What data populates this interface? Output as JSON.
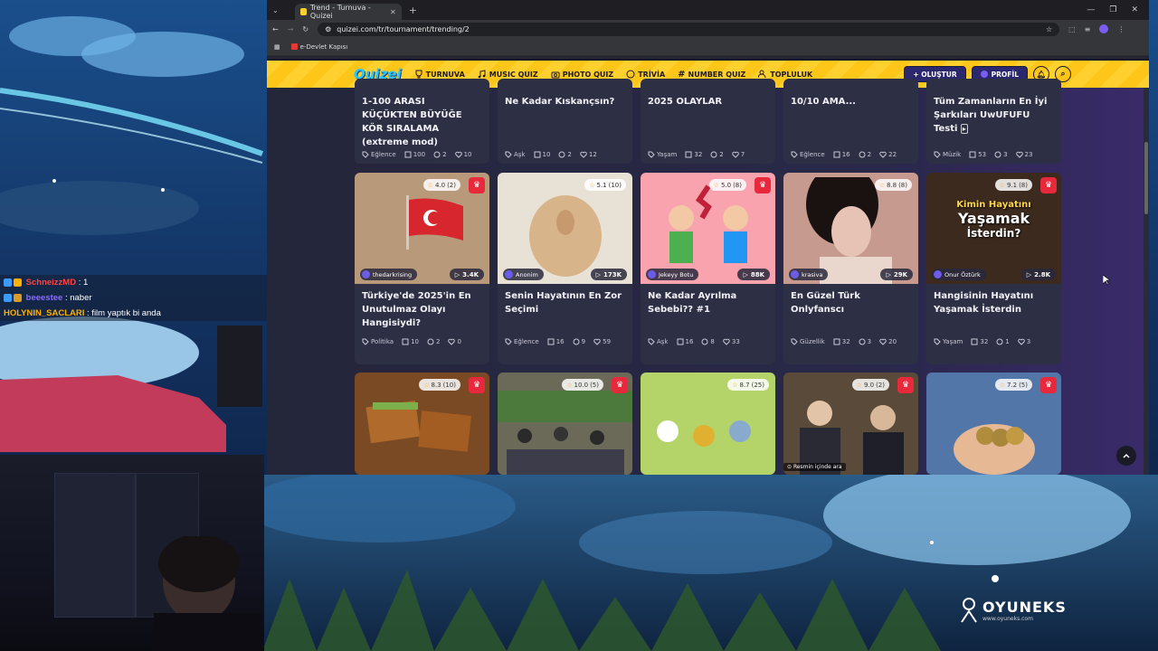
{
  "browser": {
    "tab_title": "Trend - Turnuva - Quizei",
    "url": "quizei.com/tr/tournament/trending/2",
    "bookmark": "e-Devlet Kapısı"
  },
  "site": {
    "logo": "Quizei",
    "nav": [
      "TURNUVA",
      "MUSIC QUIZ",
      "PHOTO QUIZ",
      "TRİVİA",
      "NUMBER QUIZ",
      "TOPLULUK"
    ],
    "create_label": "+ OLUŞTUR",
    "profile_label": "PROFİL"
  },
  "top_row": [
    {
      "title": "1-100 ARASI KÜÇÜKTEN BÜYÜĞE KÖR SIRALAMA (extreme mod)",
      "category": "Eğlence",
      "items": "100",
      "comments": "2",
      "likes": "10"
    },
    {
      "title": "Ne Kadar Kıskançsın?",
      "category": "Aşk",
      "items": "10",
      "comments": "2",
      "likes": "12"
    },
    {
      "title": "2025 OLAYLAR",
      "category": "Yaşam",
      "items": "32",
      "comments": "2",
      "likes": "7"
    },
    {
      "title": "10/10 AMA...",
      "category": "Eğlence",
      "items": "16",
      "comments": "2",
      "likes": "22"
    },
    {
      "title": "Tüm Zamanların En İyi Şarkıları UwUFUFU Testi",
      "category": "Müzik",
      "items": "53",
      "comments": "3",
      "likes": "23"
    }
  ],
  "mid_row": [
    {
      "title": "Türkiye'de 2025'in En Unutulmaz Olayı Hangisiydi?",
      "rating": "4.0",
      "votes": "(2)",
      "author": "thedarkrising",
      "plays": "3.4K",
      "category": "Politika",
      "items": "10",
      "comments": "2",
      "likes": "0",
      "thumb_color": "#b89a7a"
    },
    {
      "title": "Senin Hayatının En Zor Seçimi",
      "rating": "5.1",
      "votes": "(10)",
      "author": "Anonim",
      "plays": "173K",
      "category": "Eğlence",
      "items": "16",
      "comments": "9",
      "likes": "59",
      "thumb_color": "#e8e2d6"
    },
    {
      "title": "Ne Kadar Ayrılma Sebebi?? #1",
      "rating": "5.0",
      "votes": "(8)",
      "author": "Jekeyy Botu",
      "plays": "88K",
      "category": "Aşk",
      "items": "16",
      "comments": "8",
      "likes": "33",
      "thumb_color": "#f8a3ad"
    },
    {
      "title": "En Güzel Türk Onlyfanscı",
      "rating": "8.8",
      "votes": "(8)",
      "author": "krasiva",
      "plays": "29K",
      "category": "Güzellik",
      "items": "32",
      "comments": "3",
      "likes": "20",
      "thumb_color": "#c79a90"
    },
    {
      "title": "Hangisinin Hayatını Yaşamak İsterdin",
      "rating": "9.1",
      "votes": "(8)",
      "author": "Onur Öztürk",
      "plays": "2.8K",
      "category": "Yaşam",
      "items": "32",
      "comments": "1",
      "likes": "3",
      "thumb_color": "#3d2a1e",
      "thumb_text_1": "Kimin Hayatını",
      "thumb_text_2": "Yaşamak",
      "thumb_text_3": "İsterdin?"
    }
  ],
  "bottom_row": [
    {
      "rating": "8.3",
      "votes": "(10)",
      "thumb_color": "#7a4a24"
    },
    {
      "rating": "10.0",
      "votes": "(5)",
      "thumb_color": "#6b6a58"
    },
    {
      "rating": "8.7",
      "votes": "(25)",
      "thumb_color": "#b4d46a"
    },
    {
      "rating": "9.0",
      "votes": "(2)",
      "thumb_color": "#5a4a3a",
      "overlay": "Resmin içinde ara"
    },
    {
      "rating": "7.2",
      "votes": "(5)",
      "thumb_color": "#5276a8"
    }
  ],
  "chat": [
    {
      "user": "SchneizzMD",
      "text": ": 1",
      "color": "#ff4444"
    },
    {
      "user": "beeestee",
      "text": ": naber",
      "color": "#8a6bff"
    },
    {
      "user": "HOLYNIN_SACLARI",
      "text": ": film yaptık bi anda",
      "color": "#ffb000"
    }
  ],
  "watermark": {
    "name": "OYUNEKS",
    "site": "www.oyuneks.com"
  }
}
